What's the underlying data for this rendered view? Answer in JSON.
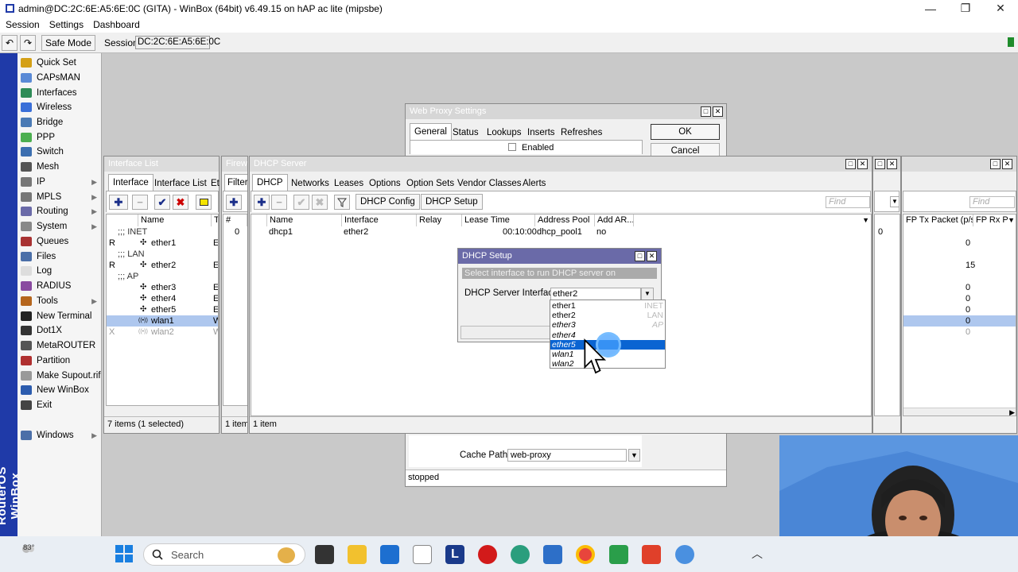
{
  "window": {
    "title": "admin@DC:2C:6E:A5:6E:0C (GITA) - WinBox (64bit) v6.49.15 on hAP ac lite (mipsbe)",
    "minimize": "—",
    "maximize": "❐",
    "close": "✕"
  },
  "menubar": [
    "Session",
    "Settings",
    "Dashboard"
  ],
  "toolbar": {
    "undo": "↶",
    "redo": "↷",
    "safe_mode": "Safe Mode",
    "session_label": "Session:",
    "session_value": "DC:2C:6E:A5:6E:0C"
  },
  "brand": "RouterOS WinBox",
  "sidebar": [
    {
      "label": "Quick Set",
      "color": "#d4a017"
    },
    {
      "label": "CAPsMAN",
      "color": "#5a8ad6"
    },
    {
      "label": "Interfaces",
      "color": "#2e8b57"
    },
    {
      "label": "Wireless",
      "color": "#3a6fd8"
    },
    {
      "label": "Bridge",
      "color": "#4a7ab5"
    },
    {
      "label": "PPP",
      "color": "#4caf50"
    },
    {
      "label": "Switch",
      "color": "#3c6fb0"
    },
    {
      "label": "Mesh",
      "color": "#555555"
    },
    {
      "label": "IP",
      "color": "#777777",
      "arrow": true
    },
    {
      "label": "MPLS",
      "color": "#777777",
      "arrow": true
    },
    {
      "label": "Routing",
      "color": "#6a6aa8",
      "arrow": true
    },
    {
      "label": "System",
      "color": "#888888",
      "arrow": true
    },
    {
      "label": "Queues",
      "color": "#a83232"
    },
    {
      "label": "Files",
      "color": "#4b6fa8"
    },
    {
      "label": "Log",
      "color": "#dddddd"
    },
    {
      "label": "RADIUS",
      "color": "#8a4aa0"
    },
    {
      "label": "Tools",
      "color": "#b5651d",
      "arrow": true
    },
    {
      "label": "New Terminal",
      "color": "#222222"
    },
    {
      "label": "Dot1X",
      "color": "#333333"
    },
    {
      "label": "MetaROUTER",
      "color": "#555555"
    },
    {
      "label": "Partition",
      "color": "#b03030"
    },
    {
      "label": "Make Supout.rif",
      "color": "#999999"
    },
    {
      "label": "New WinBox",
      "color": "#2c5cae"
    },
    {
      "label": "Exit",
      "color": "#444444"
    },
    {
      "label": "Windows",
      "color": "#4b6fa8",
      "arrow": true
    }
  ],
  "web_proxy": {
    "title": "Web Proxy Settings",
    "tabs": [
      "General",
      "Status",
      "Lookups",
      "Inserts",
      "Refreshes"
    ],
    "enabled_label": "Enabled",
    "ok": "OK",
    "cancel": "Cancel",
    "cache_path_label": "Cache Path:",
    "cache_path_value": "web-proxy",
    "status": "stopped"
  },
  "interface_list": {
    "title": "Interface List",
    "tabs": [
      "Interface",
      "Interface List",
      "Et"
    ],
    "columns": [
      "Name",
      "T"
    ],
    "rows": [
      {
        "flag": "",
        "name": ";;; INET",
        "type": "",
        "comment": true
      },
      {
        "flag": "R",
        "name": "ether1",
        "type": "E"
      },
      {
        "flag": "",
        "name": ";;; LAN",
        "type": "",
        "comment": true
      },
      {
        "flag": "R",
        "name": "ether2",
        "type": "E"
      },
      {
        "flag": "",
        "name": ";;; AP",
        "type": "",
        "comment": true
      },
      {
        "flag": "",
        "name": "ether3",
        "type": "E"
      },
      {
        "flag": "",
        "name": "ether4",
        "type": "E"
      },
      {
        "flag": "",
        "name": "ether5",
        "type": "E"
      },
      {
        "flag": "",
        "name": "wlan1",
        "type": "W",
        "selected": true
      },
      {
        "flag": "X",
        "name": "wlan2",
        "type": "W",
        "disabled": true
      }
    ],
    "status": "7 items (1 selected)"
  },
  "firewall": {
    "title": "Firewa",
    "tab": "Filter",
    "col": "#",
    "value": "0",
    "status": "1 item"
  },
  "dhcp_server": {
    "title": "DHCP Server",
    "tabs": [
      "DHCP",
      "Networks",
      "Leases",
      "Options",
      "Option Sets",
      "Vendor Classes",
      "Alerts"
    ],
    "buttons": [
      "DHCP Config",
      "DHCP Setup"
    ],
    "find_placeholder": "Find",
    "columns": [
      "Name",
      "Interface",
      "Relay",
      "Lease Time",
      "Address Pool",
      "Add AR..."
    ],
    "rows": [
      {
        "name": "dhcp1",
        "interface": "ether2",
        "relay": "",
        "lease_time": "00:10:00",
        "pool": "dhcp_pool1",
        "add_arp": "no"
      }
    ],
    "status": "1 item"
  },
  "right_panel": {
    "find_placeholder": "Find",
    "col_a": "FP Tx Packet (p/s)",
    "col_b": "FP Rx P",
    "first_value": "0",
    "values": [
      "0",
      "15",
      "0",
      "0",
      "0",
      "0",
      "0"
    ]
  },
  "dhcp_setup": {
    "title": "DHCP Setup",
    "hint": "Select interface to run DHCP server on",
    "field_label": "DHCP Server Interface:",
    "field_value": "ether2",
    "options": [
      {
        "name": "ether1",
        "comment": "INET"
      },
      {
        "name": "ether2",
        "comment": "LAN"
      },
      {
        "name": "ether3",
        "comment": "AP",
        "italic": true
      },
      {
        "name": "ether4",
        "comment": "",
        "italic": true
      },
      {
        "name": "ether5",
        "comment": "",
        "italic": true,
        "highlight": true
      },
      {
        "name": "wlan1",
        "comment": "",
        "italic": true
      },
      {
        "name": "wlan2",
        "comment": "",
        "italic": true
      }
    ]
  },
  "taskbar": {
    "weather": "83°",
    "search": "Search"
  }
}
